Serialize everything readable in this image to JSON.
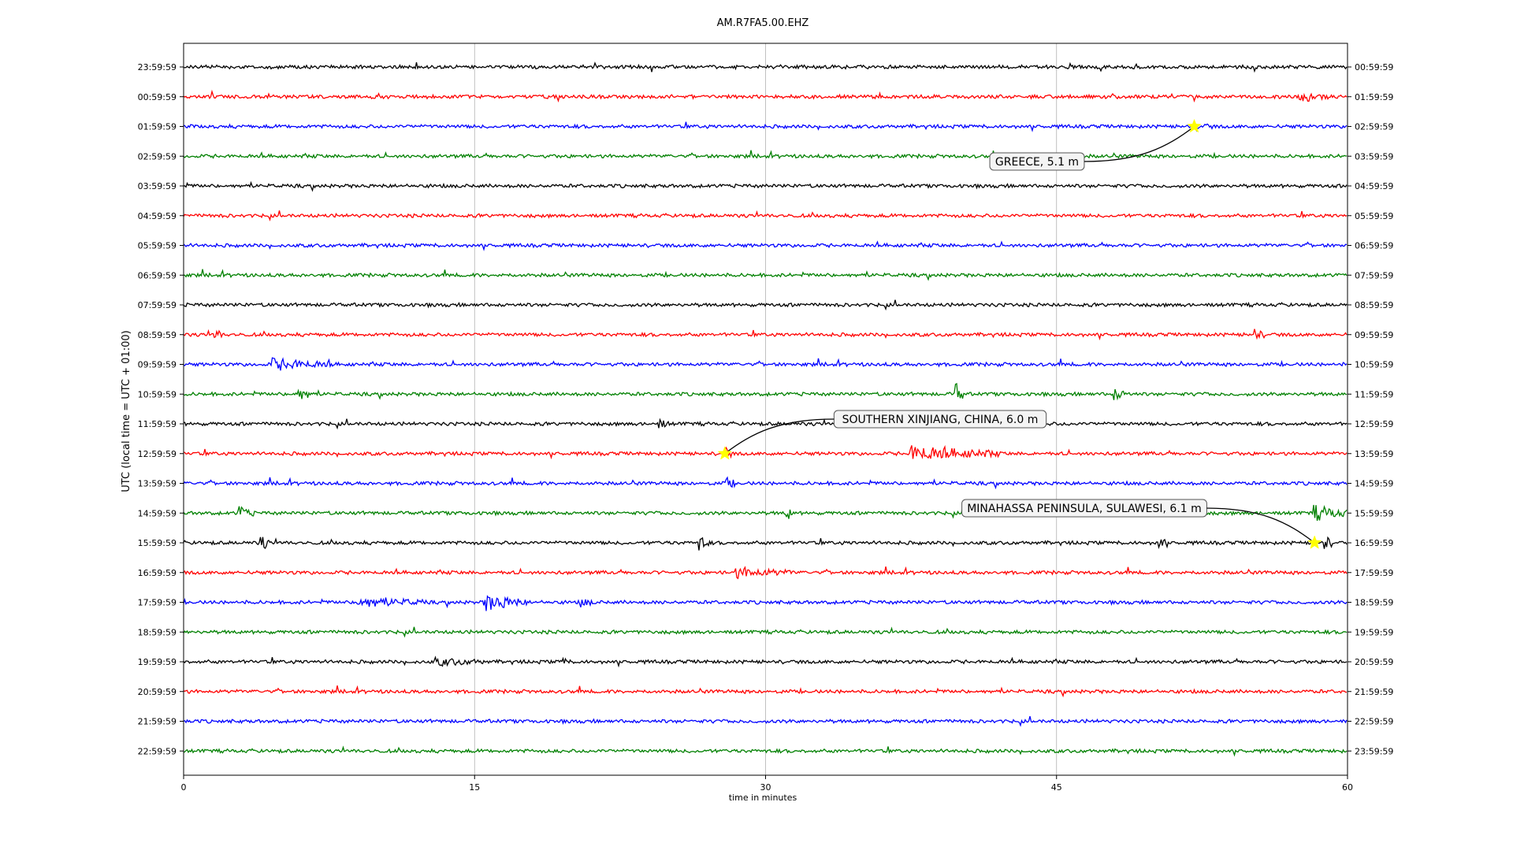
{
  "chart_data": {
    "type": "line",
    "title": "AM.R7FA5.00.EHZ",
    "xlabel": "time in minutes",
    "ylabel": "UTC (local time = UTC + 01:00)",
    "xlim": [
      0,
      60
    ],
    "x_ticks": [
      0,
      15,
      30,
      45,
      60
    ],
    "grid": "vertical",
    "colors": [
      "#000000",
      "#ff0000",
      "#0000ff",
      "#008000"
    ],
    "rows": [
      {
        "left": "23:59:59",
        "right": "00:59:59"
      },
      {
        "left": "00:59:59",
        "right": "01:59:59"
      },
      {
        "left": "01:59:59",
        "right": "02:59:59"
      },
      {
        "left": "02:59:59",
        "right": "03:59:59"
      },
      {
        "left": "03:59:59",
        "right": "04:59:59"
      },
      {
        "left": "04:59:59",
        "right": "05:59:59"
      },
      {
        "left": "05:59:59",
        "right": "06:59:59"
      },
      {
        "left": "06:59:59",
        "right": "07:59:59"
      },
      {
        "left": "07:59:59",
        "right": "08:59:59"
      },
      {
        "left": "08:59:59",
        "right": "09:59:59"
      },
      {
        "left": "09:59:59",
        "right": "10:59:59"
      },
      {
        "left": "10:59:59",
        "right": "11:59:59"
      },
      {
        "left": "11:59:59",
        "right": "12:59:59"
      },
      {
        "left": "12:59:59",
        "right": "13:59:59"
      },
      {
        "left": "13:59:59",
        "right": "14:59:59"
      },
      {
        "left": "14:59:59",
        "right": "15:59:59"
      },
      {
        "left": "15:59:59",
        "right": "16:59:59"
      },
      {
        "left": "16:59:59",
        "right": "17:59:59"
      },
      {
        "left": "17:59:59",
        "right": "18:59:59"
      },
      {
        "left": "18:59:59",
        "right": "19:59:59"
      },
      {
        "left": "19:59:59",
        "right": "20:59:59"
      },
      {
        "left": "20:59:59",
        "right": "21:59:59"
      },
      {
        "left": "21:59:59",
        "right": "22:59:59"
      },
      {
        "left": "22:59:59",
        "right": "23:59:59"
      }
    ],
    "events": [
      {
        "label": "GREECE, 5.1 m",
        "row": 2,
        "minute": 52.1
      },
      {
        "label": "SOUTHERN XINJIANG, CHINA, 6.0 m",
        "row": 13,
        "minute": 27.9
      },
      {
        "label": "MINAHASSA PENINSULA, SULAWESI, 6.1 m",
        "row": 16,
        "minute": 58.3
      }
    ],
    "bursts": [
      {
        "row": 1,
        "minute": 57.5,
        "dur": 1.5,
        "amp": 1.6
      },
      {
        "row": 2,
        "minute": 52.1,
        "dur": 1.0,
        "amp": 0.9
      },
      {
        "row": 9,
        "minute": 1.6,
        "dur": 0.4,
        "amp": 1.8
      },
      {
        "row": 9,
        "minute": 55.2,
        "dur": 0.5,
        "amp": 1.6
      },
      {
        "row": 10,
        "minute": 4.5,
        "dur": 3.2,
        "amp": 1.8
      },
      {
        "row": 11,
        "minute": 5.8,
        "dur": 0.9,
        "amp": 2.2
      },
      {
        "row": 11,
        "minute": 39.8,
        "dur": 0.4,
        "amp": 3.5
      },
      {
        "row": 11,
        "minute": 48.0,
        "dur": 0.8,
        "amp": 1.6
      },
      {
        "row": 12,
        "minute": 24.5,
        "dur": 0.5,
        "amp": 1.4
      },
      {
        "row": 13,
        "minute": 27.9,
        "dur": 0.4,
        "amp": 2.0
      },
      {
        "row": 13,
        "minute": 37.5,
        "dur": 4.5,
        "amp": 2.4
      },
      {
        "row": 14,
        "minute": 27.9,
        "dur": 0.5,
        "amp": 2.0
      },
      {
        "row": 15,
        "minute": 2.8,
        "dur": 0.8,
        "amp": 2.0
      },
      {
        "row": 15,
        "minute": 31.1,
        "dur": 0.3,
        "amp": 2.3
      },
      {
        "row": 15,
        "minute": 58.2,
        "dur": 1.8,
        "amp": 2.5
      },
      {
        "row": 16,
        "minute": 4.0,
        "dur": 0.4,
        "amp": 2.5
      },
      {
        "row": 16,
        "minute": 26.6,
        "dur": 0.5,
        "amp": 2.4
      },
      {
        "row": 16,
        "minute": 50.2,
        "dur": 0.4,
        "amp": 2.8
      },
      {
        "row": 16,
        "minute": 58.8,
        "dur": 0.4,
        "amp": 2.4
      },
      {
        "row": 17,
        "minute": 28.5,
        "dur": 3.0,
        "amp": 1.4
      },
      {
        "row": 18,
        "minute": 9.0,
        "dur": 3.5,
        "amp": 1.5
      },
      {
        "row": 18,
        "minute": 15.5,
        "dur": 2.2,
        "amp": 2.6
      },
      {
        "row": 18,
        "minute": 20.5,
        "dur": 0.6,
        "amp": 1.2
      },
      {
        "row": 20,
        "minute": 13.0,
        "dur": 2.5,
        "amp": 1.1
      },
      {
        "row": 20,
        "minute": 19.5,
        "dur": 0.3,
        "amp": 1.8
      }
    ]
  }
}
